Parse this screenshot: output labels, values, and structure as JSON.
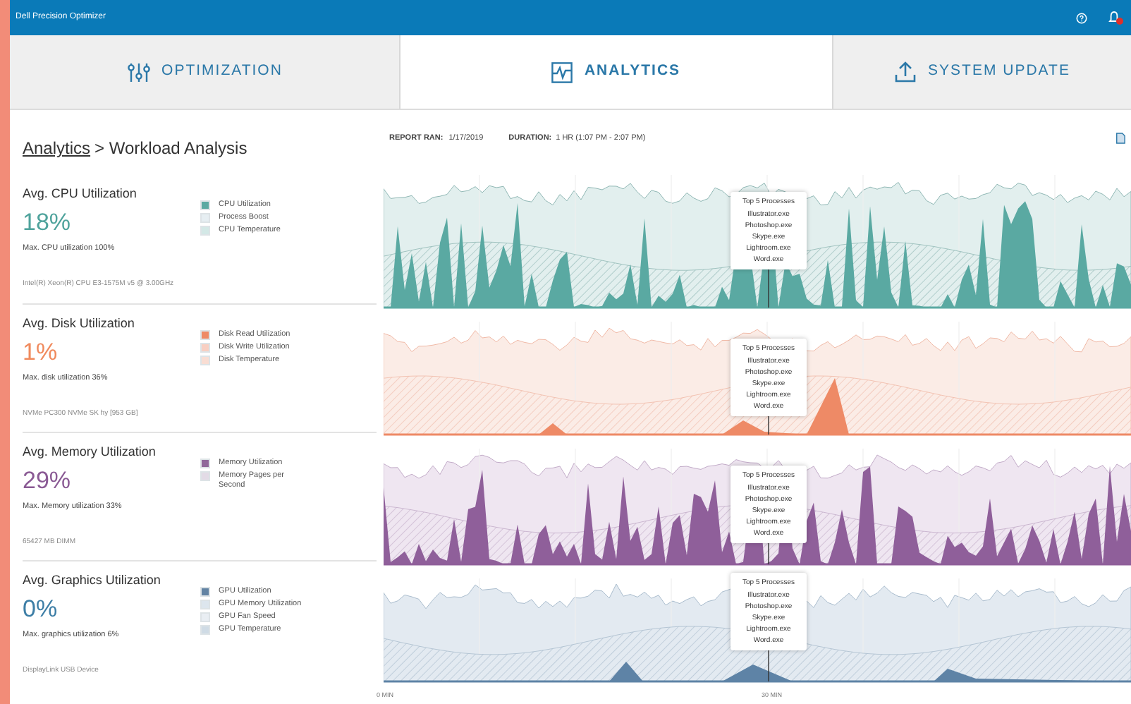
{
  "window": {
    "title": "Dell Precision Optimizer"
  },
  "tabs": [
    {
      "label": "OPTIMIZATION",
      "selected": false,
      "kind": "sliders"
    },
    {
      "label": "ANALYTICS",
      "selected": true,
      "kind": "analytics"
    },
    {
      "label": "SYSTEM UPDATE",
      "selected": false,
      "kind": "upload"
    }
  ],
  "breadcrumb": {
    "link": "Analytics",
    "current": "> Workload Analysis"
  },
  "report": {
    "ran_label": "REPORT RAN:",
    "ran_value": "1/17/2019",
    "duration_label": "DURATION:",
    "duration_value": "1 HR (1:07 PM - 2:07 PM)"
  },
  "metrics": [
    {
      "title": "Avg. CPU Utilization",
      "value": "18%",
      "color": "#4fa39c",
      "max": "Max. CPU utilization 100%",
      "device": "Intel(R) Xeon(R) CPU E3-1575M v5 @ 3.00GHz",
      "legend": [
        {
          "label": "CPU Utilization",
          "color": "#5aa9a2"
        },
        {
          "label": "Process Boost",
          "color": "#e6eef2"
        },
        {
          "label": "CPU Temperature",
          "color": "#d3e8e6"
        }
      ],
      "tooltip": {
        "title": "Top 5 Processes",
        "items": [
          "Illustrator.exe",
          "Photoshop.exe",
          "Skype.exe",
          "Lightroom.exe",
          "Word.exe"
        ]
      }
    },
    {
      "title": "Avg. Disk Utilization",
      "value": "1%",
      "color": "#f08a5d",
      "max": "Max. disk utilization 36%",
      "device": "NVMe PC300 NVMe SK hy [953 GB]",
      "legend": [
        {
          "label": "Disk Read Utilization",
          "color": "#ee8a66"
        },
        {
          "label": "Disk Write Utilization",
          "color": "#f8cfc2"
        },
        {
          "label": "Disk Temperature",
          "color": "#f9ddd3"
        }
      ],
      "tooltip": {
        "title": "Top 5 Processes",
        "items": [
          "Illustrator.exe",
          "Photoshop.exe",
          "Skype.exe",
          "Lightroom.exe",
          "Word.exe"
        ]
      }
    },
    {
      "title": "Avg. Memory Utilization",
      "value": "29%",
      "color": "#8a5a94",
      "max": "Max. Memory utilization 33%",
      "device": "65427 MB DIMM",
      "legend": [
        {
          "label": "Memory Utilization",
          "color": "#90689a"
        },
        {
          "label": "Memory Pages per Second",
          "color": "#e3dbe6"
        }
      ],
      "tooltip": {
        "title": "Top 5 Processes",
        "items": [
          "Illustrator.exe",
          "Photoshop.exe",
          "Skype.exe",
          "Lightroom.exe",
          "Word.exe"
        ]
      }
    },
    {
      "title": "Avg. Graphics Utilization",
      "value": "0%",
      "color": "#3d7ea6",
      "max": "Max. graphics utilization 6%",
      "device": "DisplayLink USB Device",
      "legend": [
        {
          "label": "GPU Utilization",
          "color": "#6283a3"
        },
        {
          "label": "GPU Memory Utilization",
          "color": "#dde6ee"
        },
        {
          "label": "GPU Fan Speed",
          "color": "#e9eef3"
        },
        {
          "label": "GPU Temperature",
          "color": "#cfdbe5"
        }
      ],
      "tooltip": {
        "title": "Top 5 Processes",
        "items": [
          "Illustrator.exe",
          "Photoshop.exe",
          "Skype.exe",
          "Lightroom.exe",
          "Word.exe"
        ]
      }
    }
  ],
  "x_axis": [
    "0 MIN",
    "30 MIN"
  ]
}
